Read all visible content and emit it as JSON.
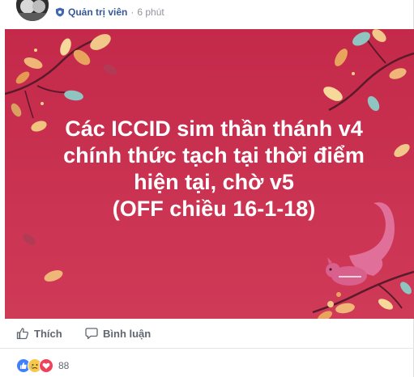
{
  "post": {
    "role_label": "Quản trị viên",
    "separator": "·",
    "time": "6 phút"
  },
  "banner": {
    "background_color": "#c5294a",
    "lines": [
      "Các ICCID sim thần thánh v4",
      "chính thức tạch tại thời điểm",
      "hiện tại, chờ v5",
      "(OFF chiều 16-1-18)"
    ]
  },
  "actions": {
    "like_label": "Thích",
    "comment_label": "Bình luận"
  },
  "reactions": {
    "icons": [
      "like-icon",
      "sad-icon",
      "love-icon"
    ],
    "count": "88"
  }
}
